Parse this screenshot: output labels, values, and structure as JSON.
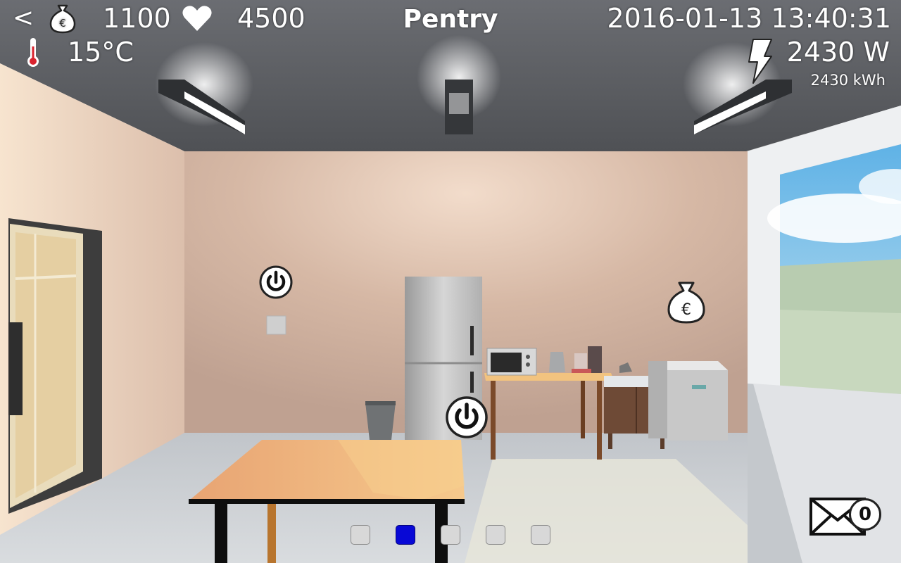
{
  "hud": {
    "back_label": "<",
    "money": "1100",
    "happiness": "4500",
    "room_title": "Pentry",
    "datetime": "2016-01-13 13:40:31",
    "temperature": "15°C",
    "power": "2430 W",
    "energy": "2430 kWh"
  },
  "room_pages": {
    "count": 5,
    "active_index": 1
  },
  "messages": {
    "unread_count": "0"
  },
  "icons": {
    "money": "euro-moneybag-icon",
    "heart": "heart-icon",
    "thermometer": "thermometer-icon",
    "power": "lightning-bolt-icon",
    "mail": "envelope-icon",
    "switch": "power-switch-icon"
  },
  "colors": {
    "active_page": "#0808d6",
    "ceiling": "#5a5c60",
    "wall": "#d8b9a6"
  }
}
